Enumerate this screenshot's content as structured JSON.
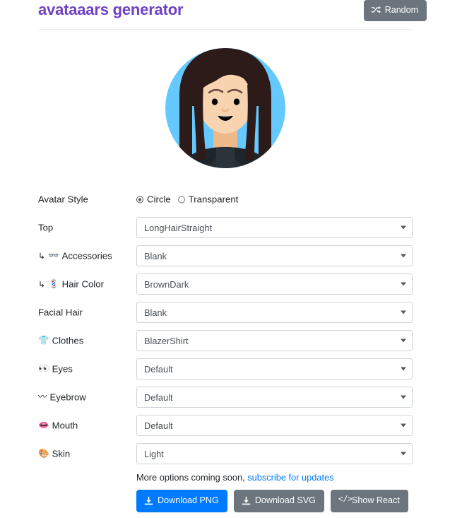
{
  "header": {
    "title": "avataaars generator",
    "random_label": "Random",
    "random_icon": "shuffle-icon"
  },
  "avatar": {
    "alt": "avatar-preview",
    "colors": {
      "background": "#65c9ff",
      "hair": "#2c1b18",
      "skin": "#f8d3b0",
      "skin_shadow": "#edb98a",
      "clothes": "#262e33",
      "mouth": "#000000",
      "eyes": "#000000",
      "pocket_square": "#ffffff"
    }
  },
  "form": {
    "style_row": {
      "label": "Avatar Style",
      "options": [
        {
          "label": "Circle",
          "selected": true
        },
        {
          "label": "Transparent",
          "selected": false
        }
      ]
    },
    "rows": [
      {
        "label": "Top",
        "icon": "",
        "icon_name": "none",
        "indent": false,
        "value": "LongHairStraight"
      },
      {
        "label": "Accessories",
        "icon": "👓",
        "icon_name": "glasses-icon",
        "indent": true,
        "value": "Blank"
      },
      {
        "label": "Hair Color",
        "icon": "💈",
        "icon_name": "barber-pole-icon",
        "indent": true,
        "value": "BrownDark"
      },
      {
        "label": "Facial Hair",
        "icon": "",
        "icon_name": "none",
        "indent": false,
        "value": "Blank"
      },
      {
        "label": "Clothes",
        "icon": "👕",
        "icon_name": "tshirt-icon",
        "indent": false,
        "value": "BlazerShirt"
      },
      {
        "label": "Eyes",
        "icon": "👀",
        "icon_name": "eyes-icon",
        "indent": false,
        "value": "Default"
      },
      {
        "label": "Eyebrow",
        "icon": "〰",
        "icon_name": "eyebrow-icon",
        "indent": false,
        "value": "Default"
      },
      {
        "label": "Mouth",
        "icon": "👄",
        "icon_name": "lips-icon",
        "indent": false,
        "value": "Default"
      },
      {
        "label": "Skin",
        "icon": "🎨",
        "icon_name": "palette-icon",
        "indent": false,
        "value": "Light"
      }
    ],
    "indent_arrow": "↳"
  },
  "footer": {
    "more_text": "More options coming soon, ",
    "link_text": "subscribe for updates",
    "buttons": [
      {
        "label": "Download PNG",
        "icon_name": "download-icon",
        "style": "primary"
      },
      {
        "label": "Download SVG",
        "icon_name": "download-icon",
        "style": "secondary"
      },
      {
        "label": "Show React",
        "icon_name": "code-icon",
        "style": "secondary"
      }
    ]
  },
  "colors": {
    "brand": "#6f42c1",
    "primary": "#007bff",
    "secondary": "#6c757d",
    "link": "#007bff",
    "border": "#ced4da"
  }
}
